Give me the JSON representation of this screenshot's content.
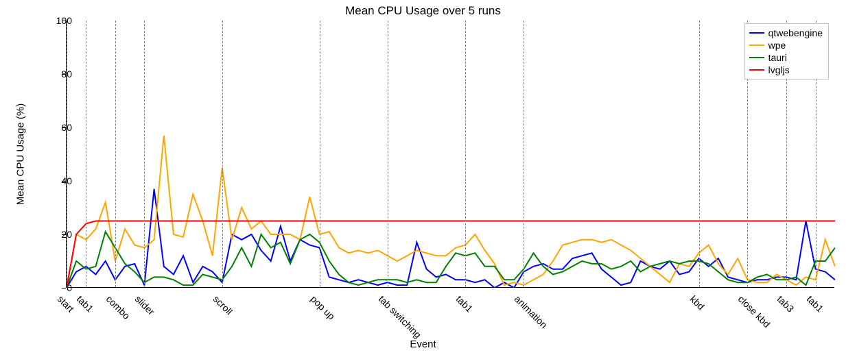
{
  "chart_data": {
    "type": "line",
    "title": "Mean CPU Usage over 5 runs",
    "xlabel": "Event",
    "ylabel": "Mean CPU Usage (%)",
    "ylim": [
      0,
      100
    ],
    "yticks": [
      0,
      20,
      40,
      60,
      80,
      100
    ],
    "n_x": 80,
    "events": [
      {
        "label": "start",
        "x": 0
      },
      {
        "label": "tab1",
        "x": 2
      },
      {
        "label": "combo",
        "x": 5
      },
      {
        "label": "slider",
        "x": 8
      },
      {
        "label": "scroll",
        "x": 16
      },
      {
        "label": "pop up",
        "x": 26
      },
      {
        "label": "tab switching",
        "x": 33
      },
      {
        "label": "tab1",
        "x": 41
      },
      {
        "label": "animation",
        "x": 47
      },
      {
        "label": "kbd",
        "x": 65
      },
      {
        "label": "close kbd",
        "x": 70
      },
      {
        "label": "tab3",
        "x": 74
      },
      {
        "label": "tab1",
        "x": 77
      }
    ],
    "series": [
      {
        "name": "qtwebengine",
        "color": "#0000ff",
        "values": [
          0,
          6,
          8,
          5,
          10,
          3,
          8,
          9,
          1,
          37,
          8,
          5,
          12,
          2,
          8,
          6,
          2,
          20,
          18,
          20,
          14,
          10,
          23,
          10,
          18,
          16,
          15,
          4,
          3,
          2,
          3,
          2,
          1,
          2,
          1,
          1,
          17,
          7,
          4,
          5,
          3,
          3,
          2,
          3,
          0,
          2,
          0,
          6,
          8,
          9,
          7,
          7,
          11,
          12,
          13,
          7,
          4,
          1,
          2,
          10,
          8,
          7,
          10,
          5,
          6,
          11,
          8,
          11,
          4,
          3,
          2,
          3,
          3,
          4,
          4,
          3,
          25,
          7,
          6,
          3
        ]
      },
      {
        "name": "wpe",
        "color": "#ffa500",
        "values": [
          0,
          20,
          18,
          22,
          32,
          10,
          22,
          16,
          15,
          18,
          57,
          20,
          19,
          35,
          25,
          12,
          45,
          18,
          30,
          22,
          25,
          20,
          20,
          20,
          18,
          34,
          20,
          21,
          15,
          13,
          14,
          13,
          14,
          12,
          10,
          12,
          14,
          13,
          12,
          12,
          15,
          16,
          20,
          14,
          9,
          1,
          2,
          1,
          3,
          5,
          10,
          16,
          17,
          18,
          18,
          17,
          18,
          16,
          14,
          11,
          8,
          5,
          2,
          9,
          8,
          13,
          16,
          9,
          5,
          11,
          3,
          2,
          2,
          5,
          3,
          1,
          4,
          3,
          18,
          8
        ]
      },
      {
        "name": "tauri",
        "color": "#008000",
        "values": [
          0,
          10,
          7,
          8,
          21,
          15,
          9,
          6,
          2,
          4,
          4,
          3,
          1,
          1,
          5,
          4,
          3,
          8,
          15,
          8,
          20,
          15,
          17,
          9,
          18,
          20,
          17,
          10,
          5,
          2,
          1,
          2,
          3,
          3,
          3,
          2,
          3,
          2,
          2,
          8,
          13,
          12,
          13,
          8,
          8,
          3,
          3,
          7,
          13,
          8,
          5,
          6,
          8,
          10,
          9,
          9,
          7,
          8,
          10,
          6,
          8,
          9,
          10,
          9,
          10,
          10,
          9,
          6,
          3,
          2,
          2,
          4,
          5,
          3,
          3,
          4,
          1,
          10,
          10,
          15
        ]
      },
      {
        "name": "lvgljs",
        "color": "#ff0000",
        "values": [
          0,
          20,
          24,
          25,
          25,
          25,
          25,
          25,
          25,
          25,
          25,
          25,
          25,
          25,
          25,
          25,
          25,
          25,
          25,
          25,
          25,
          25,
          25,
          25,
          25,
          25,
          25,
          25,
          25,
          25,
          25,
          25,
          25,
          25,
          25,
          25,
          25,
          25,
          25,
          25,
          25,
          25,
          25,
          25,
          25,
          25,
          25,
          25,
          25,
          25,
          25,
          25,
          25,
          25,
          25,
          25,
          25,
          25,
          25,
          25,
          25,
          25,
          25,
          25,
          25,
          25,
          25,
          25,
          25,
          25,
          25,
          25,
          25,
          25,
          25,
          25,
          25,
          25,
          25,
          25
        ]
      }
    ]
  },
  "legend": {
    "items": [
      "qtwebengine",
      "wpe",
      "tauri",
      "lvgljs"
    ]
  }
}
